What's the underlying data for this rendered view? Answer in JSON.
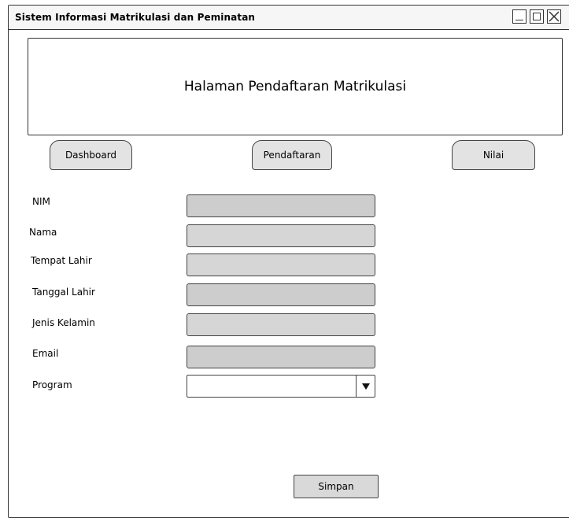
{
  "window": {
    "title": "Sistem Informasi Matrikulasi dan Peminatan",
    "controls": [
      "minimize-icon",
      "maximize-icon",
      "close-icon"
    ]
  },
  "banner": {
    "text": "Halaman Pendaftaran Matrikulasi"
  },
  "nav": {
    "dashboard": "Dashboard",
    "pendaftaran": "Pendaftaran",
    "nilai": "Nilai"
  },
  "form": {
    "fields": [
      {
        "label": "NIM",
        "value": ""
      },
      {
        "label": "Nama",
        "value": ""
      },
      {
        "label": "Tempat Lahir",
        "value": ""
      },
      {
        "label": "Tanggal Lahir",
        "value": ""
      },
      {
        "label": "Jenis Kelamin",
        "value": ""
      },
      {
        "label": "Email",
        "value": ""
      }
    ],
    "program": {
      "label": "Program",
      "selected": ""
    },
    "submit_label": "Simpan"
  },
  "colors": {
    "input_fill": "#cdcdcd",
    "button_fill": "#e3e3e3",
    "border": "#444444"
  }
}
